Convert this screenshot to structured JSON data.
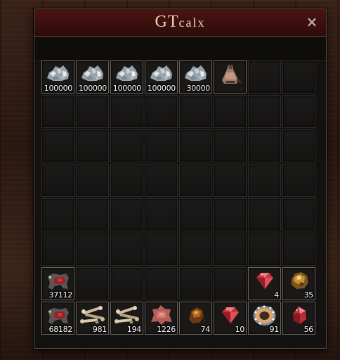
{
  "window": {
    "title_main": "GT",
    "title_small": "calx",
    "close_label": "×"
  },
  "slots": [
    {
      "icon": "silver-ore-icon",
      "qty": "100000"
    },
    {
      "icon": "silver-ore-icon",
      "qty": "100000"
    },
    {
      "icon": "silver-ore-icon",
      "qty": "100000"
    },
    {
      "icon": "silver-ore-icon",
      "qty": "100000"
    },
    {
      "icon": "silver-ore-icon",
      "qty": "30000"
    },
    {
      "icon": "furnace-bag-icon",
      "qty": ""
    },
    null,
    null,
    null,
    null,
    null,
    null,
    null,
    null,
    null,
    null,
    null,
    null,
    null,
    null,
    null,
    null,
    null,
    null,
    null,
    null,
    null,
    null,
    null,
    null,
    null,
    null,
    null,
    null,
    null,
    null,
    null,
    null,
    null,
    null,
    null,
    null,
    null,
    null,
    null,
    null,
    null,
    null,
    {
      "icon": "animal-hide-icon",
      "qty": "37112"
    },
    null,
    null,
    null,
    null,
    null,
    {
      "icon": "ruby-gem-icon",
      "qty": "4"
    },
    {
      "icon": "gold-nugget-icon",
      "qty": "35"
    },
    {
      "icon": "animal-hide-icon",
      "qty": "68182"
    },
    {
      "icon": "bone-pile-icon",
      "qty": "981"
    },
    {
      "icon": "bone-pile-icon",
      "qty": "194"
    },
    {
      "icon": "leather-icon",
      "qty": "1226"
    },
    {
      "icon": "amber-shard-icon",
      "qty": "74"
    },
    {
      "icon": "ruby-gem-icon",
      "qty": "10"
    },
    {
      "icon": "ornate-ring-icon",
      "qty": "91"
    },
    {
      "icon": "red-crystal-icon",
      "qty": "56"
    }
  ]
}
